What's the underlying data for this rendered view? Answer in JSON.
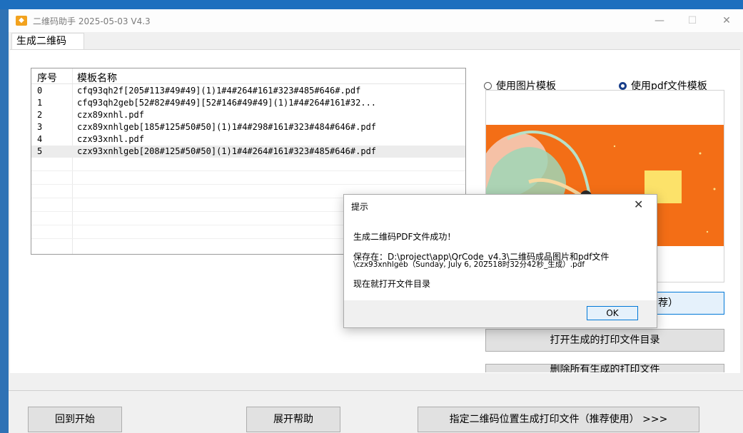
{
  "window": {
    "title": "二维码助手 2025-05-03 V4.3",
    "app_icon": "app-logo-icon",
    "controls": {
      "minimize": "—",
      "maximize": "☐",
      "close": "✕"
    }
  },
  "tab": {
    "label": "生成二维码"
  },
  "template_list": {
    "headers": [
      "序号",
      "模板名称"
    ],
    "rows": [
      {
        "index": "0",
        "name": "cfq93qh2f[205#113#49#49](1)1#4#264#161#323#485#646#.pdf"
      },
      {
        "index": "1",
        "name": "cfq93qh2geb[52#82#49#49][52#146#49#49](1)1#4#264#161#32..."
      },
      {
        "index": "2",
        "name": "czx89xnhl.pdf"
      },
      {
        "index": "3",
        "name": "czx89xnhlgeb[185#125#50#50](1)1#4#298#161#323#484#646#.pdf"
      },
      {
        "index": "4",
        "name": "czx93xnhl.pdf"
      },
      {
        "index": "5",
        "name": "czx93xnhlgeb[208#125#50#50](1)1#4#264#161#323#485#646#.pdf"
      }
    ],
    "selected_index": "5"
  },
  "template_mode": {
    "option_image": "使用图片模板",
    "option_pdf": "使用pdf文件模板",
    "selected": "pdf"
  },
  "buttons": {
    "partial_hidden_label": "荐）",
    "open_output_dir": "打开生成的打印文件目录",
    "cut_off_label": "删除所有生成的打印文件",
    "back_to_start": "回到开始",
    "expand_help": "展开帮助",
    "generate_print": "指定二维码位置生成打印文件（推荐使用） >>>"
  },
  "dialog": {
    "title": "提示",
    "line1": "生成二维码PDF文件成功！",
    "line2": "保存在：D:\\project\\app\\QrCode_v4.3\\二维码成品图片和pdf文件",
    "line3": "\\czx93xnhlgeb（Sunday, July 6, 202518时32分42秒_生成）.pdf",
    "line4": "现在就打开文件目录",
    "ok_label": "OK",
    "close_icon": "close-icon"
  },
  "colors": {
    "accent": "#0078d7",
    "preview_background": "#f36e16",
    "radio_selected": "#1a3f8a"
  }
}
